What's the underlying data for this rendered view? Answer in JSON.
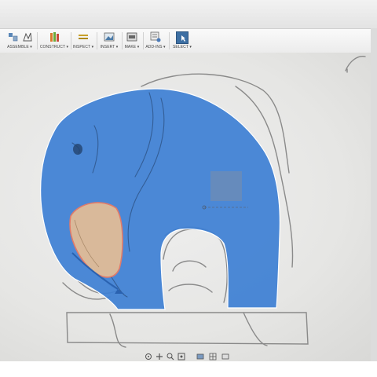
{
  "toolbar": {
    "groups": [
      {
        "label": "ASSEMBLE ▾"
      },
      {
        "label": "CONSTRUCT ▾"
      },
      {
        "label": "INSPECT ▾"
      },
      {
        "label": "INSERT ▾"
      },
      {
        "label": "MAKE ▾"
      },
      {
        "label": "ADD-INS ▾"
      },
      {
        "label": "SELECT ▾"
      }
    ]
  },
  "canvas": {
    "sketch_fill_color": "#3d7fd4",
    "ear_fill_color": "#d9b99a",
    "outline_color": "#7a7a7a"
  },
  "icons": [
    "assemble-icon",
    "joint-icon",
    "construct-icon",
    "inspect-icon",
    "insert-icon",
    "make-icon",
    "add-ins-icon",
    "select-icon",
    "orbit-icon",
    "pan-icon",
    "zoom-icon",
    "fit-icon",
    "display-icon",
    "grid-icon"
  ]
}
